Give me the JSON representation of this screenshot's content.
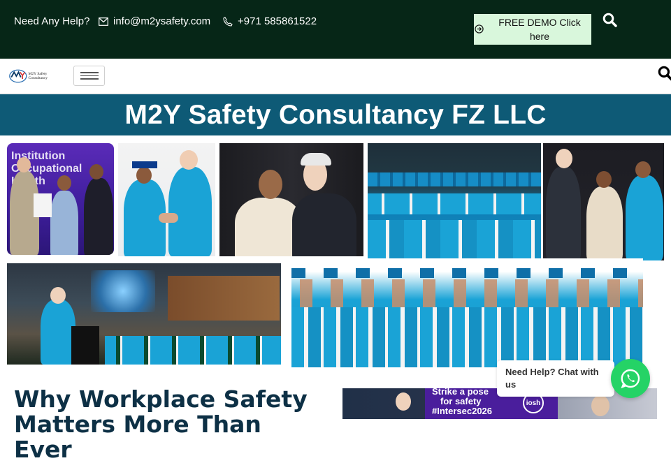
{
  "topbar": {
    "help_text": "Need Any Help?",
    "email": "info@m2ysafety.com",
    "phone": "+971 585861522",
    "demo_button": "FREE DEMO Click here"
  },
  "navbar": {
    "logo_text": "M2Y Safety Consultancy"
  },
  "hero": {
    "title": "M2Y Safety Consultancy FZ LLC"
  },
  "gallery": {
    "photo1_text": "Institution Occupational Health"
  },
  "section": {
    "heading": "Why Workplace Safety Matters More Than Ever"
  },
  "banner": {
    "line1": "Strike a pose",
    "line2": "for safety",
    "line3": "#Intersec2026",
    "badge": "iosh"
  },
  "chat": {
    "text": "Need Help? Chat with us"
  },
  "colors": {
    "topbar_bg": "#062617",
    "title_band": "#0e5a76",
    "demo_bg": "#d9f7dc",
    "whatsapp": "#25d366",
    "gown": "#1aa3d6"
  }
}
